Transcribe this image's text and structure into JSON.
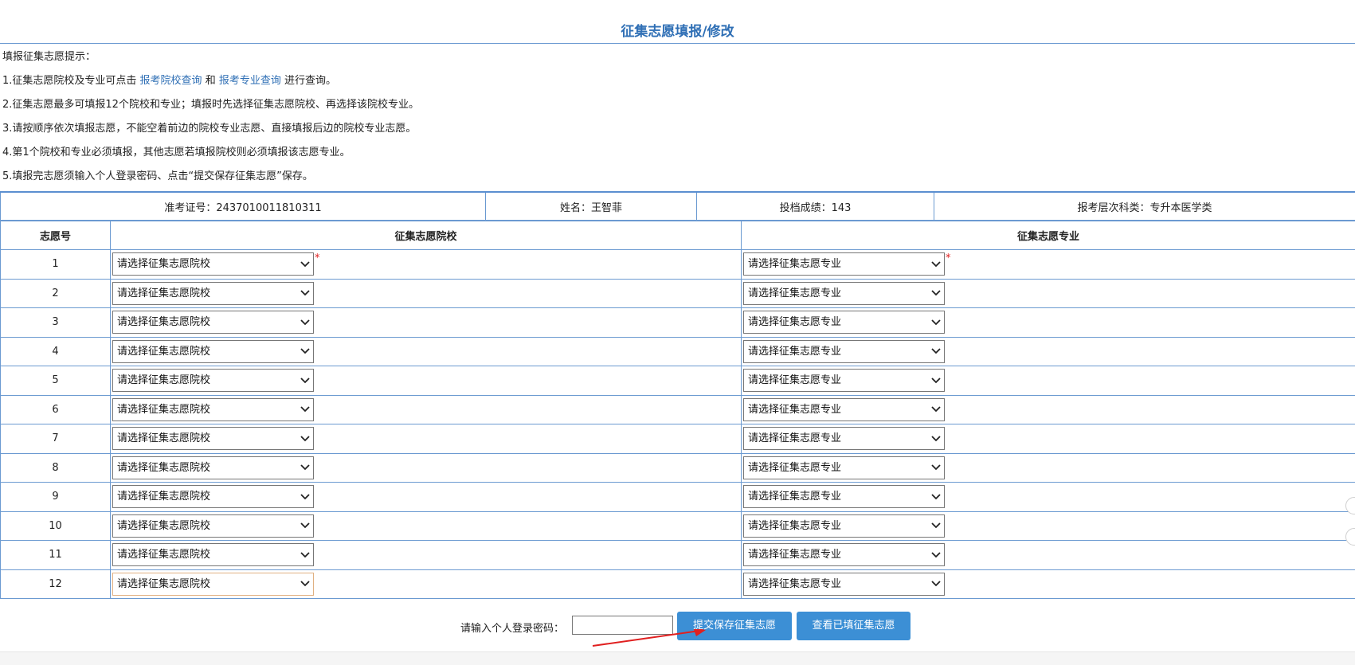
{
  "page": {
    "title": "征集志愿填报/修改"
  },
  "tips": {
    "heading": "填报征集志愿提示：",
    "line1": {
      "prefix": "1.征集志愿院校及专业可点击 ",
      "link1": "报考院校查询",
      "mid": " 和 ",
      "link2": "报考专业查询",
      "suffix": " 进行查询。"
    },
    "line2": "2.征集志愿最多可填报12个院校和专业；填报时先选择征集志愿院校、再选择该院校专业。",
    "line3": "3.请按顺序依次填报志愿，不能空着前边的院校专业志愿、直接填报后边的院校专业志愿。",
    "line4": "4.第1个院校和专业必须填报，其他志愿若填报院校则必须填报该志愿专业。",
    "line5": "5.填报完志愿须输入个人登录密码、点击“提交保存征集志愿”保存。"
  },
  "student": {
    "exam_no": "准考证号：2437010011810311",
    "name": "姓名：王智菲",
    "score": "投档成绩：143",
    "category": "报考层次科类：专升本医学类"
  },
  "table": {
    "headers": {
      "no": "志愿号",
      "school": "征集志愿院校",
      "major": "征集志愿专业"
    },
    "school_placeholder": "请选择征集志愿院校",
    "major_placeholder": "请选择征集志愿专业",
    "required_mark": "*",
    "rows": [
      "1",
      "2",
      "3",
      "4",
      "5",
      "6",
      "7",
      "8",
      "9",
      "10",
      "11",
      "12"
    ]
  },
  "footer": {
    "password_label": "请输入个人登录密码：",
    "submit_label": "提交保存征集志愿",
    "view_label": "查看已填征集志愿"
  },
  "colors": {
    "accent": "#2f6fb5",
    "border": "#6b9ad1",
    "button": "#3c8fd5",
    "required": "#e02020",
    "arrow": "#e02020"
  }
}
